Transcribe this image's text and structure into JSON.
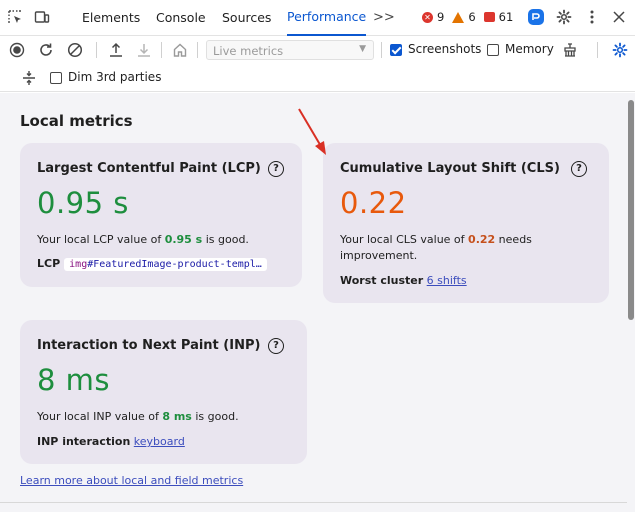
{
  "tabs": {
    "items": [
      {
        "label": "Elements"
      },
      {
        "label": "Console"
      },
      {
        "label": "Sources"
      },
      {
        "label": "Performance"
      }
    ],
    "overflow_icon": ">>",
    "errors": "9",
    "warnings": "6",
    "issues": "61"
  },
  "toolbar": {
    "live_select": "Live metrics",
    "screenshots_label": "Screenshots",
    "screenshots_checked": true,
    "memory_label": "Memory",
    "memory_checked": false,
    "dim_label": "Dim 3rd parties",
    "dim_checked": false
  },
  "main": {
    "section_title": "Local metrics",
    "lcp": {
      "title": "Largest Contentful Paint (LCP)",
      "value": "0.95 s",
      "desc_prefix": "Your local LCP value of ",
      "desc_value": "0.95 s",
      "desc_suffix": " is good.",
      "detail_key": "LCP",
      "element_tag": "img",
      "element_rest": "#FeaturedImage-product-templ…",
      "status_color": "#1e8e3e"
    },
    "cls": {
      "title": "Cumulative Layout Shift (CLS)",
      "value": "0.22",
      "desc_prefix": "Your local CLS value of ",
      "desc_value": "0.22",
      "desc_suffix": " needs",
      "desc_line2": "improvement.",
      "detail_key": "Worst cluster",
      "detail_link": "6 shifts",
      "status_color": "#e8590c"
    },
    "inp": {
      "title": "Interaction to Next Paint (INP)",
      "value": "8 ms",
      "desc_prefix": "Your local INP value of ",
      "desc_value": "8 ms",
      "desc_suffix": " is good.",
      "detail_key": "INP interaction",
      "detail_link": "keyboard",
      "status_color": "#1e8e3e"
    },
    "help_glyph": "?",
    "footer_link": "Learn more about local and field metrics"
  },
  "icons": {
    "inspect": "inspect-element-icon",
    "device": "device-toolbar-icon",
    "record": "record-icon",
    "reload": "reload-record-icon",
    "clear": "clear-icon",
    "upload": "upload-icon",
    "download": "download-icon",
    "home": "home-icon",
    "gc": "garbage-collect-icon",
    "settings": "gear-icon",
    "more": "kebab-menu-icon",
    "close": "close-icon",
    "extension": "extension-icon",
    "capture_settings": "capture-settings-icon",
    "dim": "dim-icon"
  },
  "colors": {
    "accent": "#0b57d0",
    "good": "#1e8e3e",
    "needs_improvement": "#e8590c",
    "card_bg": "#e9e5ef",
    "panel_bg": "#f4f4f7",
    "annotation_arrow": "#d93025"
  }
}
